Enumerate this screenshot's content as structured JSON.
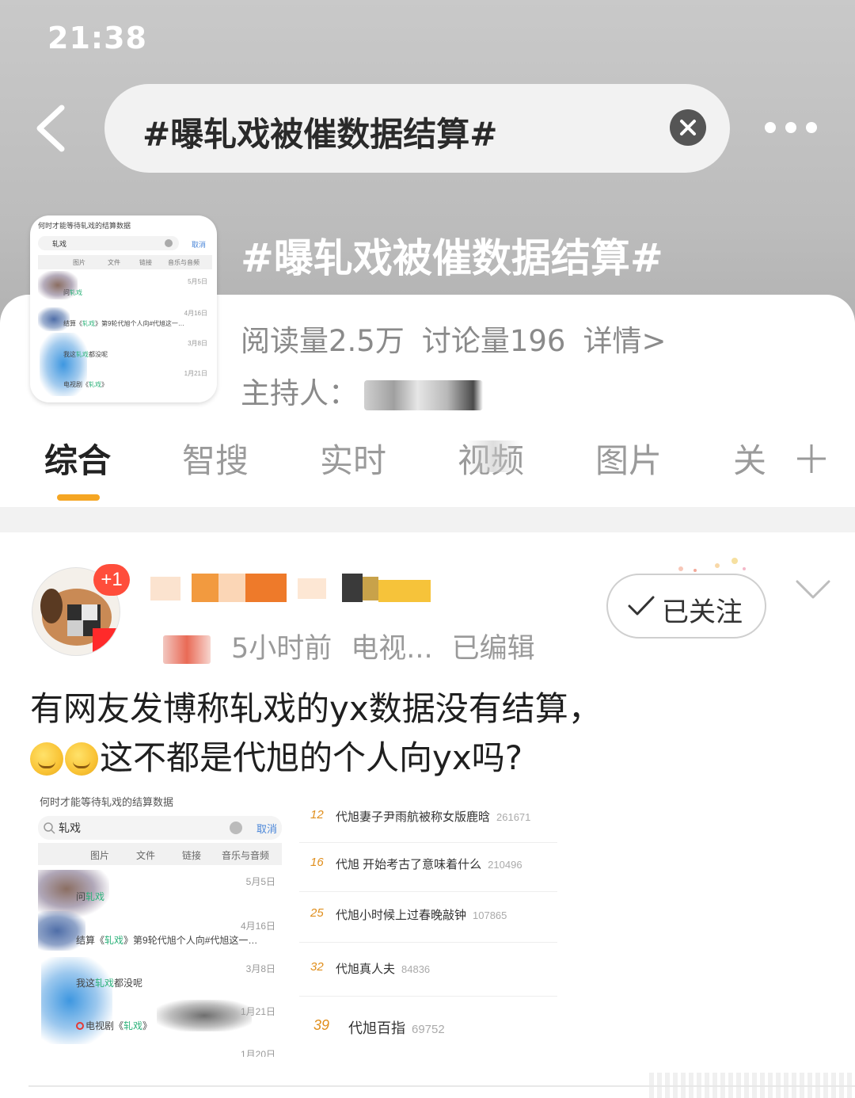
{
  "status_bar": {
    "time": "21:38"
  },
  "search": {
    "query": "#曝轧戏被催数据结算#"
  },
  "topic": {
    "title": "#曝轧戏被催数据结算#",
    "reads": "阅读量2.5万",
    "discussions": "讨论量196",
    "details": "详情>",
    "host_label": "主持人："
  },
  "tabs": [
    {
      "label": "综合"
    },
    {
      "label": "智搜"
    },
    {
      "label": "实时"
    },
    {
      "label": "视频"
    },
    {
      "label": "图片"
    },
    {
      "label": "关"
    }
  ],
  "post": {
    "badge": "+1",
    "time": "5小时前",
    "source": "电视...",
    "edited": "已编辑",
    "follow_label": "已关注",
    "text_line1": "有网友发博称轧戏的yx数据没有结算，",
    "text_line2": "这不都是代旭的个人向yx吗?"
  },
  "screenshot": {
    "title": "何时才能等待轧戏的结算数据",
    "query": "轧戏",
    "cancel": "取消",
    "filters": [
      "图片",
      "文件",
      "链接",
      "音乐与音频"
    ],
    "rows": [
      {
        "date": "5月5日",
        "pre": "问",
        "hl": "轧戏",
        "post": ""
      },
      {
        "date": "4月16日",
        "pre": "结算《",
        "hl": "轧戏",
        "post": "》第9轮代旭个人向#代旭这一…"
      },
      {
        "date": "3月8日",
        "pre": "我这",
        "hl": "轧戏",
        "post": "都没呢"
      },
      {
        "date": "1月21日",
        "pre": "电视剧《",
        "hl": "轧戏",
        "post": "》"
      },
      {
        "date": "1月20日",
        "pre": "",
        "hl": "",
        "post": ""
      }
    ]
  },
  "ranking": [
    {
      "rank": "12",
      "text": "代旭妻子尹雨航被称女版鹿晗",
      "count": "261671"
    },
    {
      "rank": "16",
      "text": "代旭 开始考古了意味着什么",
      "count": "210496"
    },
    {
      "rank": "25",
      "text": "代旭小时候上过春晚敲钟",
      "count": "107865"
    },
    {
      "rank": "32",
      "text": "代旭真人夫",
      "count": "84836"
    },
    {
      "rank": "39",
      "text": "代旭百指",
      "count": "69752"
    }
  ],
  "colors": {
    "accent": "#f5a623",
    "highlight_green": "#2db27a",
    "rank_orange": "#e08f1d",
    "badge_red": "#ff4d3b"
  }
}
